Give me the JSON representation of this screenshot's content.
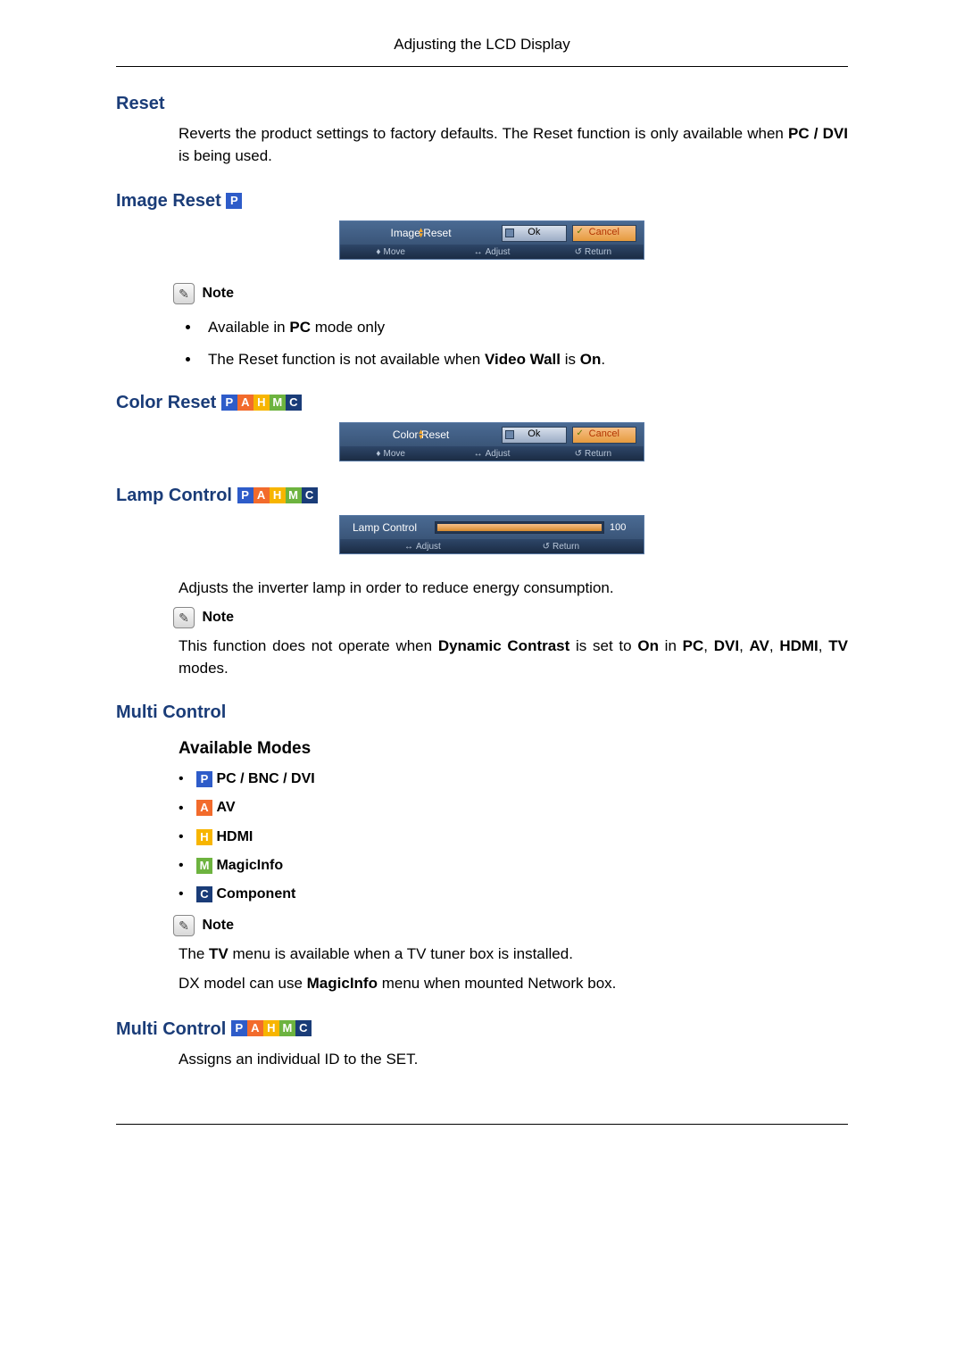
{
  "header": "Adjusting the LCD Display",
  "labels": {
    "note": "Note",
    "move": "Move",
    "adjust": "Adjust",
    "return": "Return",
    "ok": "Ok",
    "cancel": "Cancel"
  },
  "badges": {
    "P": "P",
    "A": "A",
    "H": "H",
    "M": "M",
    "C": "C"
  },
  "sections": {
    "reset": {
      "title": "Reset",
      "p1a": "Reverts the product settings to factory defaults. The Reset function is only available when ",
      "p1b": "PC / DVI",
      "p1c": " is being used."
    },
    "image_reset": {
      "title": "Image Reset ",
      "osd_title": "Image Reset",
      "bullets": {
        "0a": "Available in ",
        "0b": "PC",
        "0c": " mode only",
        "1a": "The Reset function is not available when ",
        "1b": "Video Wall",
        "1c": " is ",
        "1d": "On",
        "1e": "."
      }
    },
    "color_reset": {
      "title": "Color Reset ",
      "osd_title": "Color Reset"
    },
    "lamp_control": {
      "title": "Lamp Control ",
      "osd_title": "Lamp Control",
      "value": "100",
      "p1": "Adjusts the inverter lamp in order to reduce energy consumption.",
      "p2a": "This function does not operate when ",
      "p2b": "Dynamic Contrast",
      "p2c": " is set to ",
      "p2d": "On",
      "p2e": " in ",
      "p2f": "PC",
      "p2g": ", ",
      "p2h": "DVI",
      "p2i": ", ",
      "p2j": "AV",
      "p2k": ", ",
      "p2l": "HDMI",
      "p2m": ", ",
      "p2n": "TV",
      "p2o": " modes."
    },
    "multi_control": {
      "title": "Multi Control",
      "available_modes": "Available Modes",
      "modes": {
        "0": "PC / BNC / DVI",
        "1": "AV",
        "2": "HDMI",
        "3": "MagicInfo",
        "4": "Component"
      },
      "p1a": "The ",
      "p1b": "TV",
      "p1c": " menu is available when a TV tuner box is installed.",
      "p2a": "DX model can use ",
      "p2b": "MagicInfo",
      "p2c": " menu when mounted Network box."
    },
    "multi_control2": {
      "title": "Multi Control ",
      "p1": "Assigns an individual ID to the SET."
    }
  }
}
